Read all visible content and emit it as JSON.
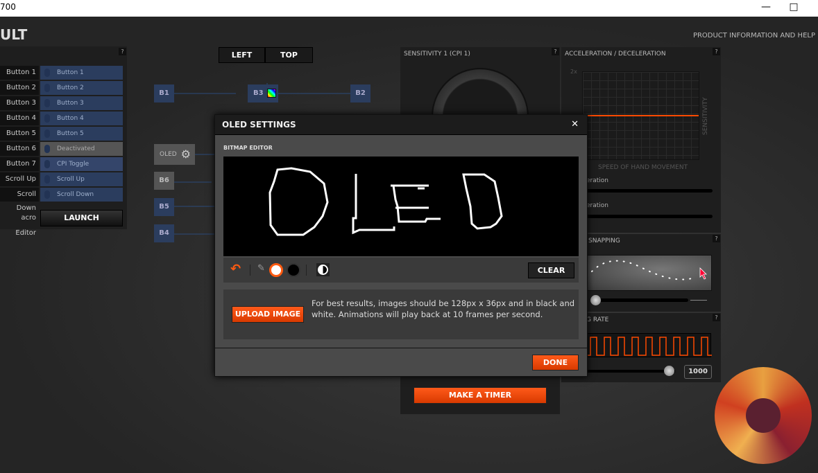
{
  "window": {
    "title": "700",
    "maximize_icon": "□"
  },
  "app": {
    "title": "ULT",
    "help_link": "PRODUCT INFORMATION AND HELP"
  },
  "buttons_panel": {
    "help": "?",
    "rows": [
      {
        "label": "Button 1",
        "value": "Button 1",
        "type": "normal"
      },
      {
        "label": "Button 2",
        "value": "Button 2",
        "type": "normal"
      },
      {
        "label": "Button 3",
        "value": "Button 3",
        "type": "normal"
      },
      {
        "label": "Button 4",
        "value": "Button 4",
        "type": "normal"
      },
      {
        "label": "Button 5",
        "value": "Button 5",
        "type": "normal"
      },
      {
        "label": "Button 6",
        "value": "Deactivated",
        "type": "deact"
      },
      {
        "label": "Button 7",
        "value": "CPI Toggle",
        "type": "cpi"
      },
      {
        "label": "Scroll Up",
        "value": "Scroll Up",
        "type": "normal"
      },
      {
        "label": "Scroll Down",
        "value": "Scroll Down",
        "type": "normal"
      }
    ],
    "macro_label": "acro Editor",
    "launch": "LAUNCH"
  },
  "view_tabs": {
    "left": "LEFT",
    "top": "TOP"
  },
  "nodes": {
    "b1": "B1",
    "b2": "B2",
    "b3": "B3",
    "b4": "B4",
    "b5": "B5",
    "b6": "B6",
    "oled": "OLED"
  },
  "sensitivity": {
    "title": "SENSITIVITY 1 (CPI 1)",
    "help": "?",
    "timer_button": "MAKE A TIMER"
  },
  "acceleration": {
    "title": "ACCELERATION / DECELERATION",
    "help": "?",
    "y_tick": "2x",
    "y_label": "SENSITIVITY",
    "x_label": "SPEED OF HAND MOVEMENT",
    "slider1_label": "eration",
    "slider2_label": "eration"
  },
  "snapping": {
    "title": "SNAPPING",
    "help": "?"
  },
  "polling": {
    "title": "G RATE",
    "help": "?",
    "value": "1000"
  },
  "modal": {
    "title": "OLED SETTINGS",
    "close": "✕",
    "section": "BITMAP EDITOR",
    "clear": "CLEAR",
    "upload": "UPLOAD IMAGE",
    "info": "For best results, images should be 128px x 36px and in black and white. Animations will play back at 10 frames per second.",
    "done": "DONE"
  },
  "colors": {
    "accent": "#ff4a00",
    "panel": "#1e1e1e",
    "button_blue": "#2b3d5e"
  }
}
